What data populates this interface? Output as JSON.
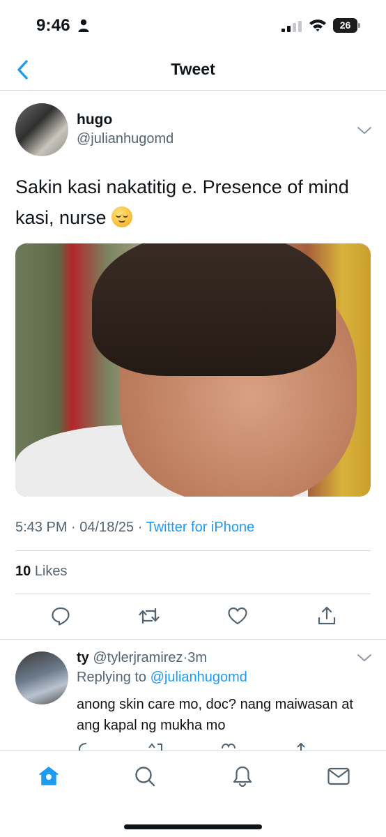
{
  "status_bar": {
    "time": "9:46",
    "battery": "26"
  },
  "header": {
    "title": "Tweet"
  },
  "tweet": {
    "display_name": "hugo",
    "handle": "@julianhugomd",
    "text": "Sakin kasi nakatitig e. Presence of mind kasi, nurse",
    "time": "5:43 PM",
    "date": "04/18/25",
    "separator": "·",
    "source": "Twitter for iPhone",
    "likes_count": "10",
    "likes_label": "Likes"
  },
  "reply": {
    "display_name": "ty",
    "handle": "@tylerjramirez",
    "separator": "·",
    "age": "3m",
    "replying_to_label": "Replying to",
    "replying_to_handle": "@julianhugomd",
    "text": "anong skin care mo, doc? nang maiwasan at ang kapal ng mukha mo"
  },
  "colors": {
    "accent": "#1d9bf0",
    "text": "#0f1419",
    "muted": "#536471",
    "divider": "#cfd9de"
  },
  "icons": {
    "actions": [
      "reply-icon",
      "retweet-icon",
      "like-icon",
      "share-icon"
    ],
    "tabs": [
      "home-icon",
      "search-icon",
      "notifications-icon",
      "messages-icon"
    ]
  }
}
